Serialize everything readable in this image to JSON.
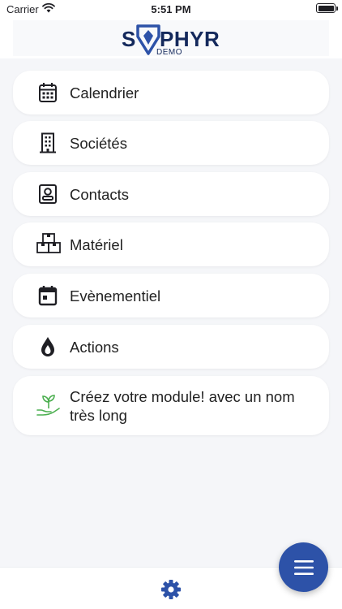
{
  "status_bar": {
    "carrier": "Carrier",
    "time": "5:51 PM"
  },
  "header": {
    "logo_left": "S",
    "logo_right": "PHYR",
    "logo_sub": "DEMO",
    "brand_color": "#14295c",
    "gem_color": "#2d52a8"
  },
  "menu": {
    "items": [
      {
        "label": "Calendrier",
        "icon": "calendar-grid-icon"
      },
      {
        "label": "Sociétés",
        "icon": "building-icon"
      },
      {
        "label": "Contacts",
        "icon": "contact-card-icon"
      },
      {
        "label": "Matériel",
        "icon": "boxes-icon"
      },
      {
        "label": "Evènementiel",
        "icon": "calendar-event-icon"
      },
      {
        "label": "Actions",
        "icon": "drop-icon"
      },
      {
        "label": "Créez votre module! avec un nom très long",
        "icon": "plant-hand-icon",
        "icon_color": "#4caf50"
      }
    ]
  },
  "bottom_bar": {
    "settings_icon": "gear-icon",
    "fab_icon": "hamburger-icon",
    "fab_color": "#2d52a8"
  }
}
